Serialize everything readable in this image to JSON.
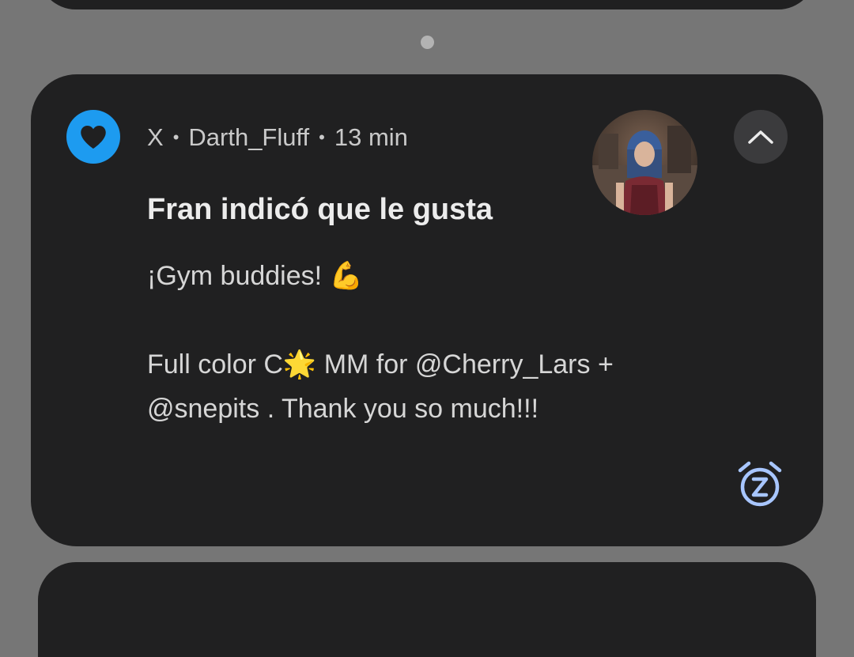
{
  "notification": {
    "app_name": "X",
    "separator": "•",
    "account": "Darth_Fluff",
    "time": "13 min",
    "title": "Fran indicó que le gusta",
    "body": {
      "line1": "¡Gym buddies! 💪",
      "line2": "Full color C🌟 MM for @Cherry_Lars +",
      "line3": "@snepits . Thank you so much!!!"
    },
    "icons": {
      "app": "heart-icon",
      "collapse": "chevron-up-icon",
      "snooze": "snooze-alarm-icon"
    }
  },
  "colors": {
    "app_accent": "#1d9bf0",
    "card_background": "#202021",
    "shade_background": "#767676",
    "snooze_icon": "#a8c6ff"
  }
}
